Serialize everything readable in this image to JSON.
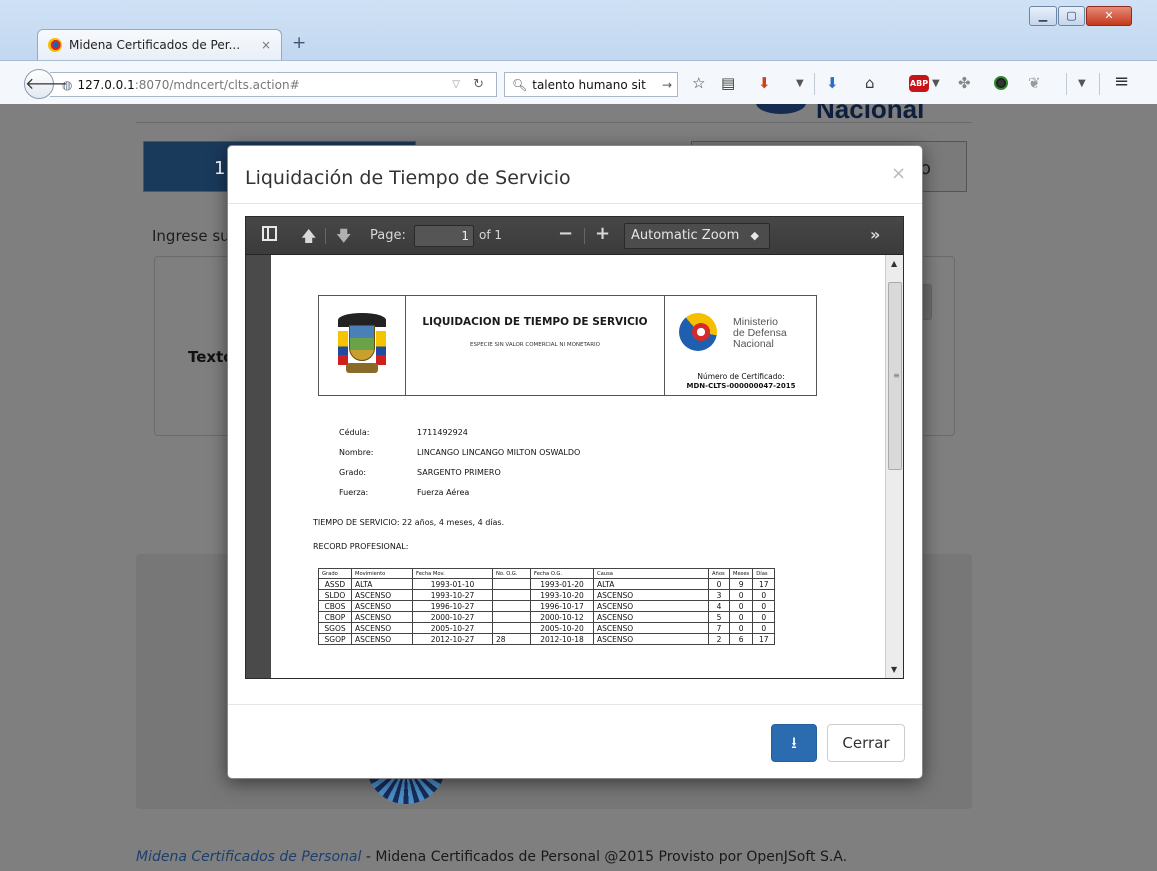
{
  "browser": {
    "tab_title": "Midena Certificados de Per...",
    "tab_close": "×",
    "new_tab": "+",
    "url_host": "127.0.0.1",
    "url_path": ":8070/mdncert/clts.action#",
    "search_text": "talento humano sit",
    "window_controls": {
      "minimize": "▁",
      "maximize": "▢",
      "close": "✕"
    },
    "toolbar_icons": [
      "bookmark-star-icon",
      "reading-list-icon",
      "pocket-icon",
      "download-icon",
      "home-icon",
      "adblock-plus-icon",
      "extension-icon",
      "extension-circle-icon",
      "extension-feather-icon",
      "menu-icon"
    ],
    "abp_label": "ABP"
  },
  "page": {
    "header_logo_text": "Nacional",
    "step1_label": "1",
    "step3_label": "o",
    "instruction": "Ingrese su",
    "form_label": "Texto",
    "footer_link": "Midena Certificados de Personal",
    "footer_text": " - Midena Certificados de Personal @2015 Provisto por OpenJSoft S.A."
  },
  "modal": {
    "title": "Liquidación de Tiempo de Servicio",
    "close_glyph": "×",
    "download_icon": "download-icon",
    "close_button": "Cerrar"
  },
  "viewer": {
    "page_label": "Page:",
    "page_value": "1",
    "page_of": "of 1",
    "zoom_option": "Automatic Zoom",
    "minus": "−",
    "plus": "+",
    "more": "»"
  },
  "document": {
    "title": "LIQUIDACION DE TIEMPO DE SERVICIO",
    "subtitle": "ESPECIE SIN VALOR COMERCIAL NI MONETARIO",
    "ministry_line1": "Ministerio",
    "ministry_line2": "de Defensa",
    "ministry_line3": "Nacional",
    "cert_label": "Número de Certificado:",
    "cert_number": "MDN-CLTS-000000047-2015",
    "fields": {
      "cedula_label": "Cédula:",
      "cedula_value": "1711492924",
      "nombre_label": "Nombre:",
      "nombre_value": "LINCANGO LINCANGO MILTON OSWALDO",
      "grado_label": "Grado:",
      "grado_value": "SARGENTO PRIMERO",
      "fuerza_label": "Fuerza:",
      "fuerza_value": "Fuerza Aérea"
    },
    "tiempo_servicio": "TIEMPO DE SERVICIO:  22 años, 4 meses, 4 días.",
    "record_label": "RECORD PROFESIONAL:",
    "table": {
      "headers": [
        "Grado",
        "Movimiento",
        "Fecha Mov.",
        "No. O.G.",
        "Fecha O.G.",
        "Causa",
        "Años",
        "Meses",
        "Días"
      ],
      "rows": [
        [
          "ASSD",
          "ALTA",
          "1993-01-10",
          "",
          "1993-01-20",
          "ALTA",
          "0",
          "9",
          "17"
        ],
        [
          "SLDO",
          "ASCENSO",
          "1993-10-27",
          "",
          "1993-10-20",
          "ASCENSO",
          "3",
          "0",
          "0"
        ],
        [
          "CBOS",
          "ASCENSO",
          "1996-10-27",
          "",
          "1996-10-17",
          "ASCENSO",
          "4",
          "0",
          "0"
        ],
        [
          "CBOP",
          "ASCENSO",
          "2000-10-27",
          "",
          "2000-10-12",
          "ASCENSO",
          "5",
          "0",
          "0"
        ],
        [
          "SGOS",
          "ASCENSO",
          "2005-10-27",
          "",
          "2005-10-20",
          "ASCENSO",
          "7",
          "0",
          "0"
        ],
        [
          "SGOP",
          "ASCENSO",
          "2012-10-27",
          "28",
          "2012-10-18",
          "ASCENSO",
          "2",
          "6",
          "17"
        ]
      ]
    }
  },
  "colors": {
    "primary_button": "#2b6cb0",
    "overlay": "#7f7f7f",
    "viewer_toolbar": "#404040"
  }
}
